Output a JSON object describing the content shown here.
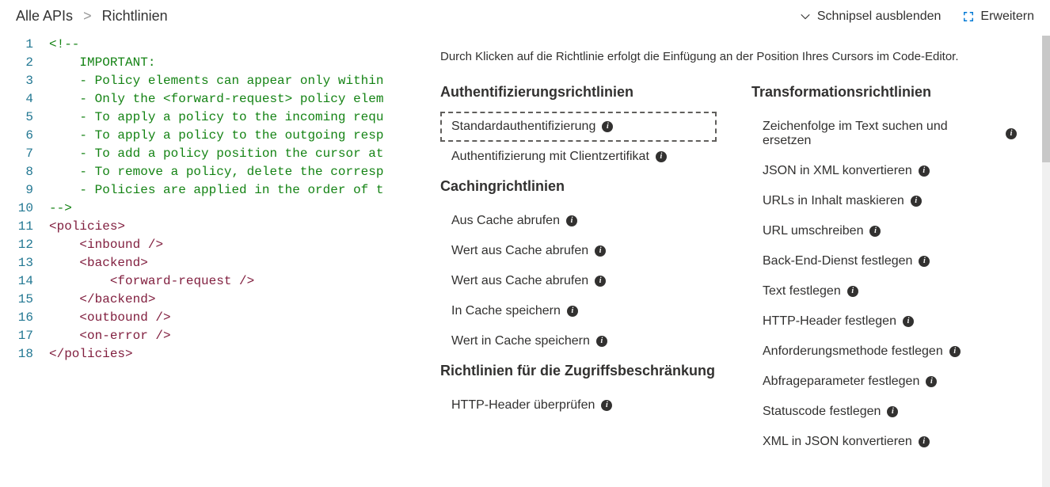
{
  "breadcrumb": {
    "root": "Alle APIs",
    "current": "Richtlinien"
  },
  "actions": {
    "hide_snippets": "Schnipsel ausblenden",
    "expand": "Erweitern"
  },
  "editor": {
    "lines": [
      {
        "n": "1",
        "raw": "<!--",
        "type": "comment"
      },
      {
        "n": "2",
        "raw": "    IMPORTANT:",
        "type": "comment"
      },
      {
        "n": "3",
        "raw": "    - Policy elements can appear only within",
        "type": "comment"
      },
      {
        "n": "4",
        "raw": "    - Only the <forward-request> policy elem",
        "type": "comment"
      },
      {
        "n": "5",
        "raw": "    - To apply a policy to the incoming requ",
        "type": "comment"
      },
      {
        "n": "6",
        "raw": "    - To apply a policy to the outgoing resp",
        "type": "comment"
      },
      {
        "n": "7",
        "raw": "    - To add a policy position the cursor at",
        "type": "comment"
      },
      {
        "n": "8",
        "raw": "    - To remove a policy, delete the corresp",
        "type": "comment"
      },
      {
        "n": "9",
        "raw": "    - Policies are applied in the order of t",
        "type": "comment"
      },
      {
        "n": "10",
        "raw": "-->",
        "type": "comment"
      },
      {
        "n": "11",
        "type": "tag",
        "indent": "",
        "open": "<",
        "name": "policies",
        "close": ">"
      },
      {
        "n": "12",
        "type": "tag",
        "indent": "    ",
        "open": "<",
        "name": "inbound",
        "close": " />"
      },
      {
        "n": "13",
        "type": "tag",
        "indent": "    ",
        "open": "<",
        "name": "backend",
        "close": ">"
      },
      {
        "n": "14",
        "type": "tag",
        "indent": "        ",
        "open": "<",
        "name": "forward-request",
        "close": " />"
      },
      {
        "n": "15",
        "type": "tag",
        "indent": "    ",
        "open": "</",
        "name": "backend",
        "close": ">"
      },
      {
        "n": "16",
        "type": "tag",
        "indent": "    ",
        "open": "<",
        "name": "outbound",
        "close": " />"
      },
      {
        "n": "17",
        "type": "tag",
        "indent": "    ",
        "open": "<",
        "name": "on-error",
        "close": " />"
      },
      {
        "n": "18",
        "type": "tag",
        "indent": "",
        "open": "</",
        "name": "policies",
        "close": ">"
      }
    ]
  },
  "panel": {
    "intro": "Durch Klicken auf die Richtlinie erfolgt die Einfügung an der Position Ihres Cursors im Code-Editor.",
    "col1_groups": [
      {
        "title": "Authentifizierungsrichtlinien",
        "items": [
          {
            "label": "Standardauthentifizierung",
            "selected": true
          },
          {
            "label": "Authentifizierung mit Clientzertifikat"
          }
        ]
      },
      {
        "title": "Cachingrichtlinien",
        "items": [
          {
            "label": "Aus Cache abrufen"
          },
          {
            "label": "Wert aus Cache abrufen"
          },
          {
            "label": "Wert aus Cache abrufen"
          },
          {
            "label": "In Cache speichern"
          },
          {
            "label": "Wert in Cache speichern"
          }
        ]
      },
      {
        "title": "Richtlinien für die Zugriffsbeschränkung",
        "items": [
          {
            "label": "HTTP-Header überprüfen"
          }
        ]
      }
    ],
    "col2_groups": [
      {
        "title": "Transformationsrichtlinien",
        "items": [
          {
            "label": "Zeichenfolge im Text suchen und ersetzen"
          },
          {
            "label": "JSON in XML konvertieren"
          },
          {
            "label": "URLs in Inhalt maskieren"
          },
          {
            "label": "URL umschreiben"
          },
          {
            "label": "Back-End-Dienst festlegen"
          },
          {
            "label": "Text festlegen"
          },
          {
            "label": "HTTP-Header festlegen"
          },
          {
            "label": "Anforderungsmethode festlegen"
          },
          {
            "label": "Abfrageparameter festlegen"
          },
          {
            "label": "Statuscode festlegen"
          },
          {
            "label": "XML in JSON konvertieren"
          }
        ]
      }
    ]
  }
}
